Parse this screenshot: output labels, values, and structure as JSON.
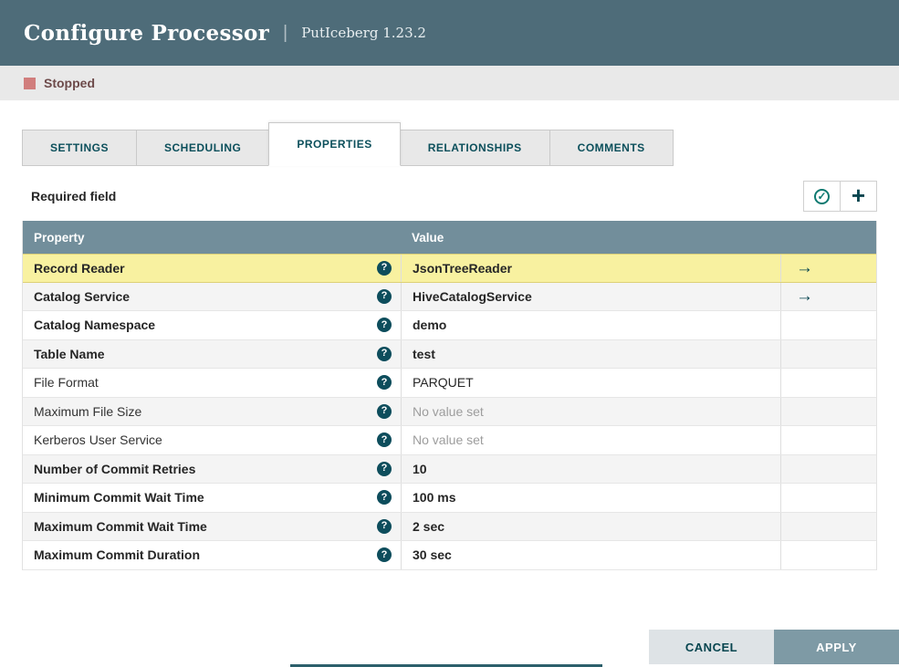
{
  "header": {
    "title": "Configure Processor",
    "separator": "|",
    "subtitle": "PutIceberg 1.23.2"
  },
  "status": {
    "label": "Stopped"
  },
  "tabs": [
    {
      "label": "SETTINGS",
      "active": false
    },
    {
      "label": "SCHEDULING",
      "active": false
    },
    {
      "label": "PROPERTIES",
      "active": true
    },
    {
      "label": "RELATIONSHIPS",
      "active": false
    },
    {
      "label": "COMMENTS",
      "active": false
    }
  ],
  "panel": {
    "required_field_label": "Required field",
    "check_glyph": "✓",
    "plus_glyph": "+",
    "help_glyph": "?",
    "arrow_glyph": "→"
  },
  "table": {
    "columns": {
      "property": "Property",
      "value": "Value"
    },
    "rows": [
      {
        "property": "Record Reader",
        "required": true,
        "value": "JsonTreeReader",
        "no_value": false,
        "has_arrow": true,
        "highlighted": true
      },
      {
        "property": "Catalog Service",
        "required": true,
        "value": "HiveCatalogService",
        "no_value": false,
        "has_arrow": true,
        "highlighted": false
      },
      {
        "property": "Catalog Namespace",
        "required": true,
        "value": "demo",
        "no_value": false,
        "has_arrow": false,
        "highlighted": false
      },
      {
        "property": "Table Name",
        "required": true,
        "value": "test",
        "no_value": false,
        "has_arrow": false,
        "highlighted": false
      },
      {
        "property": "File Format",
        "required": false,
        "value": "PARQUET",
        "no_value": false,
        "has_arrow": false,
        "highlighted": false
      },
      {
        "property": "Maximum File Size",
        "required": false,
        "value": "No value set",
        "no_value": true,
        "has_arrow": false,
        "highlighted": false
      },
      {
        "property": "Kerberos User Service",
        "required": false,
        "value": "No value set",
        "no_value": true,
        "has_arrow": false,
        "highlighted": false
      },
      {
        "property": "Number of Commit Retries",
        "required": true,
        "value": "10",
        "no_value": false,
        "has_arrow": false,
        "highlighted": false
      },
      {
        "property": "Minimum Commit Wait Time",
        "required": true,
        "value": "100 ms",
        "no_value": false,
        "has_arrow": false,
        "highlighted": false
      },
      {
        "property": "Maximum Commit Wait Time",
        "required": true,
        "value": "2 sec",
        "no_value": false,
        "has_arrow": false,
        "highlighted": false
      },
      {
        "property": "Maximum Commit Duration",
        "required": true,
        "value": "30 sec",
        "no_value": false,
        "has_arrow": false,
        "highlighted": false
      }
    ]
  },
  "footer": {
    "cancel_label": "CANCEL",
    "apply_label": "APPLY"
  },
  "colors": {
    "header_bg": "#4e6c79",
    "status_bar_bg": "#e9e9e9",
    "stopped_icon": "#d17e7d",
    "table_header_bg": "#728e9b",
    "highlight_row_bg": "#f8f1a0",
    "accent_teal": "#07454f",
    "apply_button_bg": "#7e9aa5",
    "cancel_button_bg": "#dee3e6"
  }
}
